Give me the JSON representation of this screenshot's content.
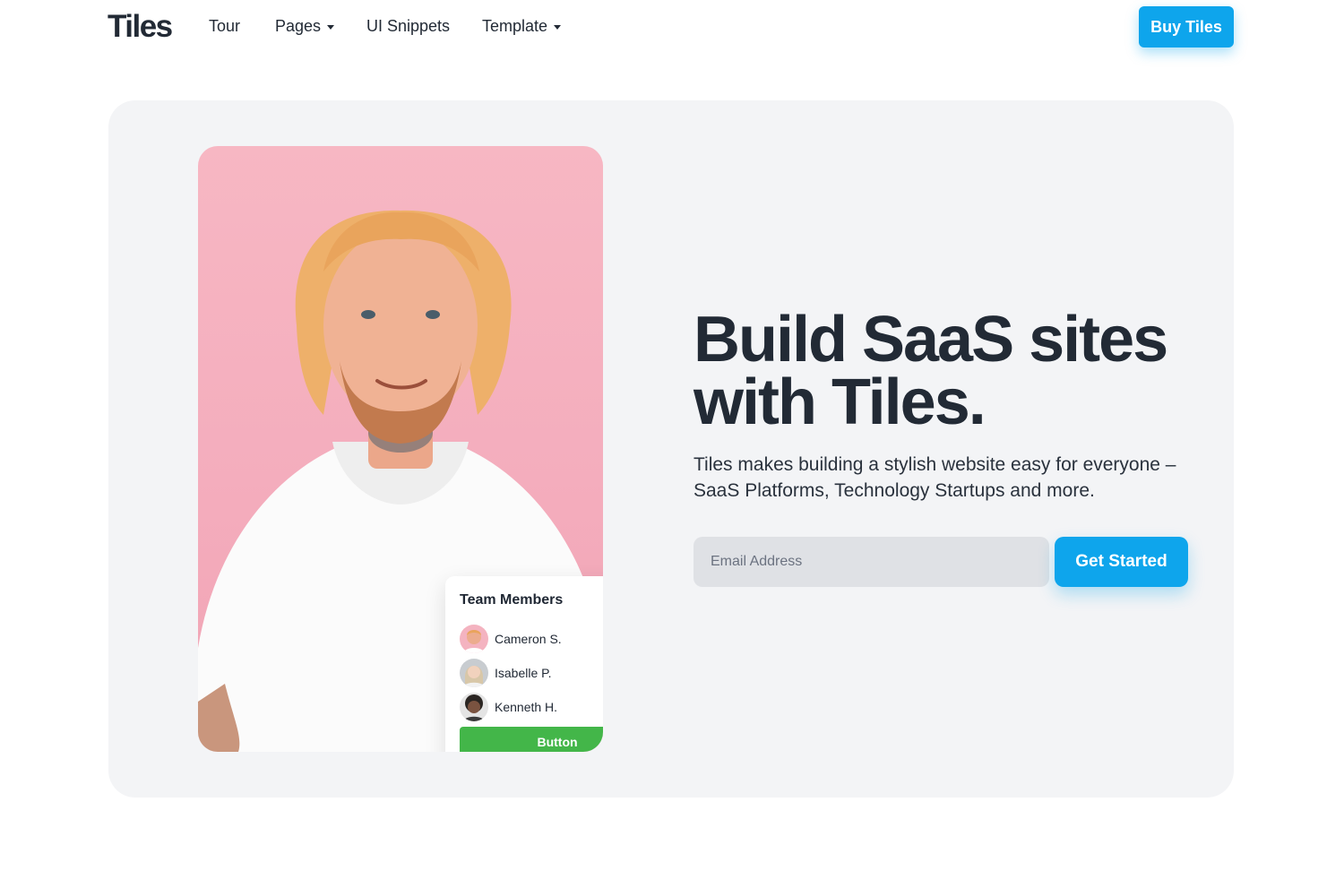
{
  "header": {
    "logo": "Tiles",
    "nav": [
      {
        "label": "Tour",
        "dropdown": false
      },
      {
        "label": "Pages",
        "dropdown": true
      },
      {
        "label": "UI Snippets",
        "dropdown": false
      },
      {
        "label": "Template",
        "dropdown": true
      }
    ],
    "buy_label": "Buy Tiles"
  },
  "hero": {
    "headline": "Build SaaS sites with Tiles.",
    "subtext": "Tiles makes building a stylish website easy for everyone – SaaS Platforms, Technology Startups and more.",
    "email_placeholder": "Email Address",
    "cta_label": "Get Started"
  },
  "team_card": {
    "title": "Team Members",
    "members": [
      {
        "name": "Cameron S.",
        "avatar": "avatar-cameron"
      },
      {
        "name": "Isabelle P.",
        "avatar": "avatar-isabelle"
      },
      {
        "name": "Kenneth H.",
        "avatar": "avatar-kenneth"
      }
    ],
    "button_label": "Button"
  },
  "colors": {
    "accent": "#0ea5ec",
    "button_green": "#43b649",
    "hero_bg": "#f3f4f6",
    "photo_bg": "#f6b4c1",
    "text_dark": "#222a35"
  }
}
